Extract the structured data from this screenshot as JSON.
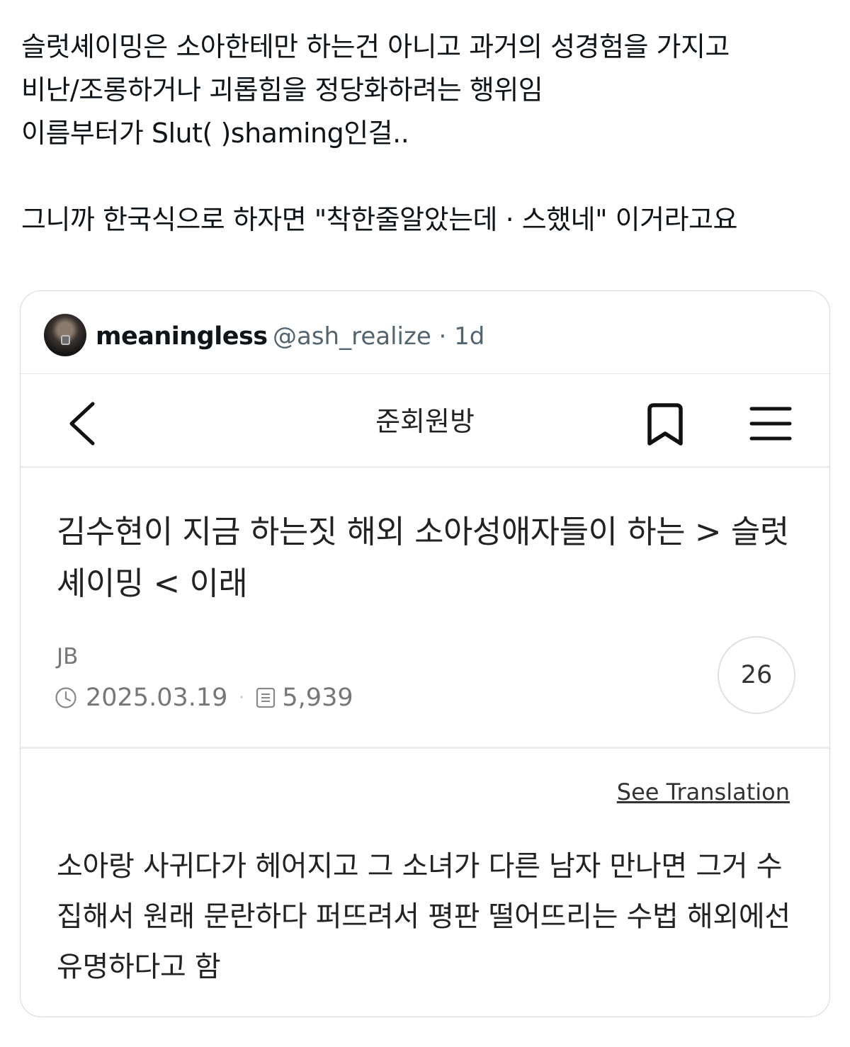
{
  "post": {
    "lines": [
      "슬럿셰이밍은 소아한테만 하는건 아니고 과거의 성경험을 가지고",
      "비난/조롱하거나 괴롭힘을 정당화하려는 행위임",
      "이름부터가 Slut(      )shaming인걸..",
      "그니까 한국식으로 하자면 \"착한줄알았는데 ·   스했네\" 이거라고요"
    ]
  },
  "quote": {
    "display_name": "meaningless",
    "handle_time": "@ash_realize · 1d"
  },
  "screenshot": {
    "board_title": "준회원방",
    "article_title": "김수현이 지금 하는짓 해외 소아성애자들이 하는 > 슬럿셰이밍 < 이래",
    "author": "JB",
    "date": "2025.03.19",
    "views": "5,939",
    "comment_count": "26",
    "see_translation": "See Translation",
    "body": "소아랑 사귀다가 헤어지고 그 소녀가 다른 남자 만나면 그거 수집해서 원래 문란하다 퍼뜨려서 평판 떨어뜨리는 수법 해외에선 유명하다고 함"
  },
  "icons": {
    "back": "chevron-left-icon",
    "bookmark": "bookmark-icon",
    "menu": "hamburger-menu-icon",
    "clock": "clock-icon",
    "views": "document-icon"
  }
}
